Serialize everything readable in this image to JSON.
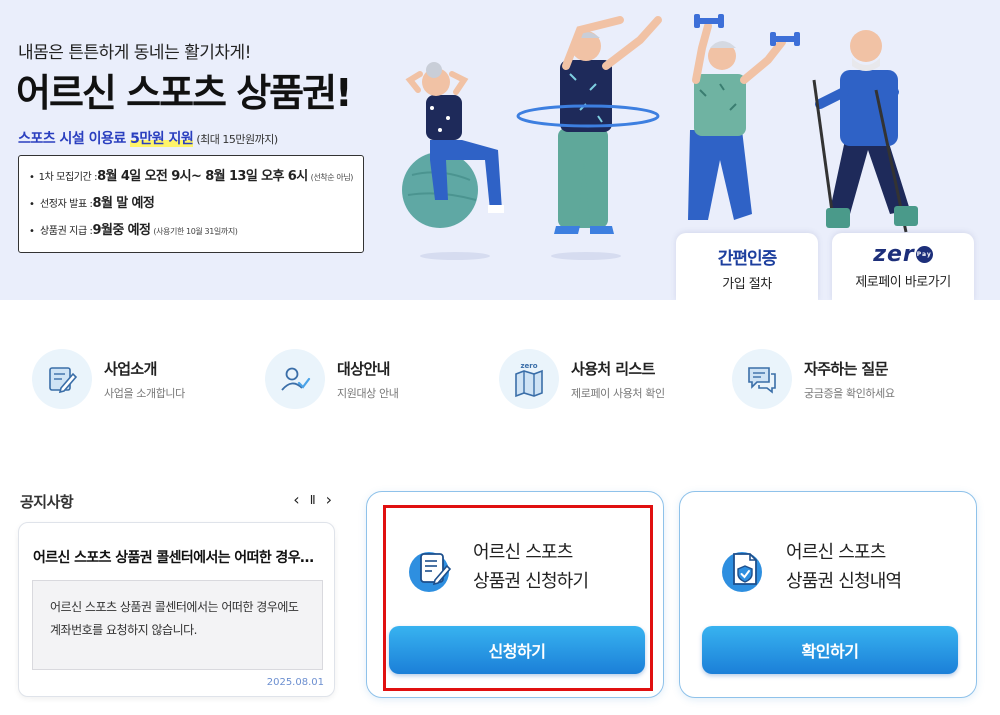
{
  "hero": {
    "tagline": "내몸은 튼튼하게 동네는 활기차게!",
    "title": "어르신 스포츠 상품권!",
    "support_prefix": "스포츠 시설 이용료 ",
    "support_amount": "5만원 지원",
    "support_note": "(최대 15만원까지)",
    "info": [
      {
        "label": "1차 모집기간 : ",
        "value": "8월 4일 오전 9시~ 8월 13일 오후 6시",
        "note": "(선착순 아님)"
      },
      {
        "label": "선정자 발표 : ",
        "value": "8월 말 예정",
        "note": ""
      },
      {
        "label": "상품권 지급 : ",
        "value": "9월중 예정",
        "note": "(사용기한 10월 31일까지)"
      }
    ],
    "cards": {
      "simple_auth": {
        "title": "간편인증",
        "sub": "가입 절차"
      },
      "zeropay": {
        "logo": "zer",
        "badge": "Pay",
        "sub": "제로페이 바로가기"
      }
    }
  },
  "quick_menu": [
    {
      "title": "사업소개",
      "desc": "사업을 소개합니다",
      "icon": "document-pen-icon"
    },
    {
      "title": "대상안내",
      "desc": "지원대상 안내",
      "icon": "user-check-icon"
    },
    {
      "title": "사용처 리스트",
      "desc": "제로페이 사용처 확인",
      "icon": "zero-map-icon",
      "icon_label": "zero"
    },
    {
      "title": "자주하는 질문",
      "desc": "궁금증을 확인하세요",
      "icon": "chat-icon"
    }
  ],
  "notice": {
    "title": "공지사항",
    "controls": {
      "prev": "‹",
      "pause": "Ⅱ",
      "next": "›"
    },
    "headline": "어르신 스포츠 상품권 콜센터에서는 어떠한 경우에도 계좌번호를 요청하지 않습니다.",
    "body": "어르신 스포츠 상품권 콜센터에서는 어떠한 경우에도 계좌번호를 요청하지 않습니다.",
    "date": "2025.08.01"
  },
  "actions": {
    "apply": {
      "line1": "어르신 스포츠",
      "line2": "상품권 신청하기",
      "button": "신청하기",
      "icon": "application-form-icon"
    },
    "check": {
      "line1": "어르신 스포츠",
      "line2": "상품권 신청내역",
      "button": "확인하기",
      "icon": "document-check-icon"
    }
  },
  "colors": {
    "accent": "#1b7fd8",
    "highlight": "#e01010",
    "hero_bg": "#eaeefb",
    "title_blue": "#2a3fbf"
  }
}
